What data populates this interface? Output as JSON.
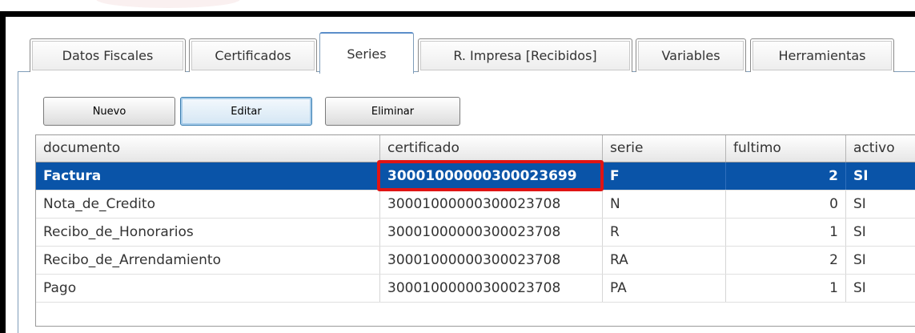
{
  "tabs": [
    {
      "label": "Datos Fiscales",
      "active": false
    },
    {
      "label": "Certificados",
      "active": false
    },
    {
      "label": "Series",
      "active": true
    },
    {
      "label": "R. Impresa [Recibidos]",
      "active": false
    },
    {
      "label": "Variables",
      "active": false
    },
    {
      "label": "Herramientas",
      "active": false
    }
  ],
  "toolbar": {
    "new_label": "Nuevo",
    "edit_label": "Editar",
    "delete_label": "Eliminar"
  },
  "table": {
    "columns": [
      "documento",
      "certificado",
      "serie",
      "fultimo",
      "activo"
    ],
    "rows": [
      {
        "documento": "Factura",
        "certificado": "30001000000300023699",
        "serie": "F",
        "fultimo": "2",
        "activo": "SI"
      },
      {
        "documento": "Nota_de_Credito",
        "certificado": "30001000000300023708",
        "serie": "N",
        "fultimo": "0",
        "activo": "SI"
      },
      {
        "documento": "Recibo_de_Honorarios",
        "certificado": "30001000000300023708",
        "serie": "R",
        "fultimo": "1",
        "activo": "SI"
      },
      {
        "documento": "Recibo_de_Arrendamiento",
        "certificado": "30001000000300023708",
        "serie": "RA",
        "fultimo": "2",
        "activo": "SI"
      },
      {
        "documento": "Pago",
        "certificado": "30001000000300023708",
        "serie": "PA",
        "fultimo": "1",
        "activo": "SI"
      }
    ],
    "selected_row": 0
  },
  "colors": {
    "selection": "#0a54a8",
    "highlight_box": "#e01414",
    "active_tab_border": "#5b8ec9"
  }
}
